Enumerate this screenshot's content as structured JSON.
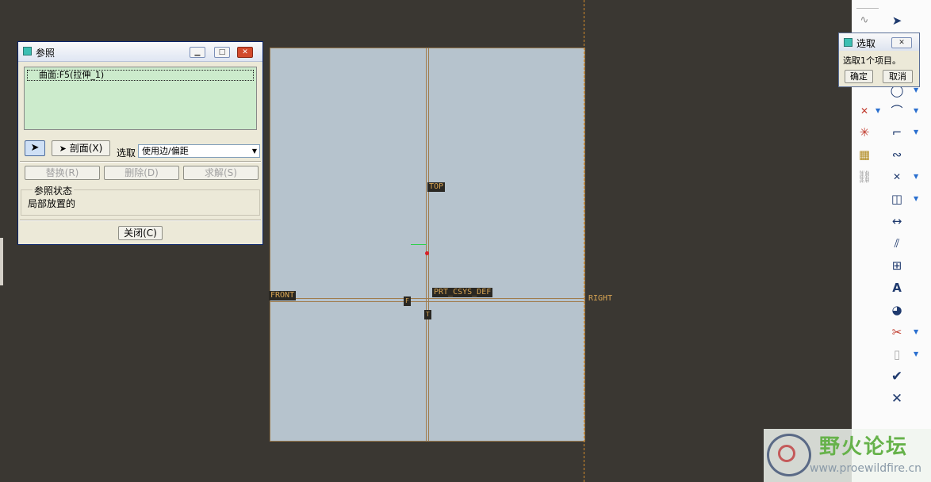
{
  "canvas": {
    "datums": {
      "top_label": "TOP",
      "front_label": "FRONT",
      "right_label": "RIGHT",
      "csys_label": "PRT_CSYS_DEF",
      "f_label": "F",
      "t_label": "T"
    }
  },
  "ref_dialog": {
    "title": "参照",
    "list_item": "曲面:F5(拉伸_1)",
    "section_button": "剖面(X)",
    "select_label": "选取",
    "select_value": "使用边/偏距",
    "replace_button": "替换(R)",
    "delete_button": "删除(D)",
    "solve_button": "求解(S)",
    "status_group_label": "参照状态",
    "status_text": "局部放置的",
    "close_button": "关闭(C)"
  },
  "select_dialog": {
    "title": "选取",
    "message": "选取1个项目。",
    "ok_button": "确定",
    "cancel_button": "取消"
  },
  "watermark": {
    "title": "野火论坛",
    "url": "www.proewildfire.cn"
  },
  "colors": {
    "canvas_bg": "#3a3732",
    "sketch_fill": "#b6c3cd",
    "datum_line": "#a07c4c",
    "datum_text": "#d7a453",
    "list_bg": "#ccebcc"
  }
}
